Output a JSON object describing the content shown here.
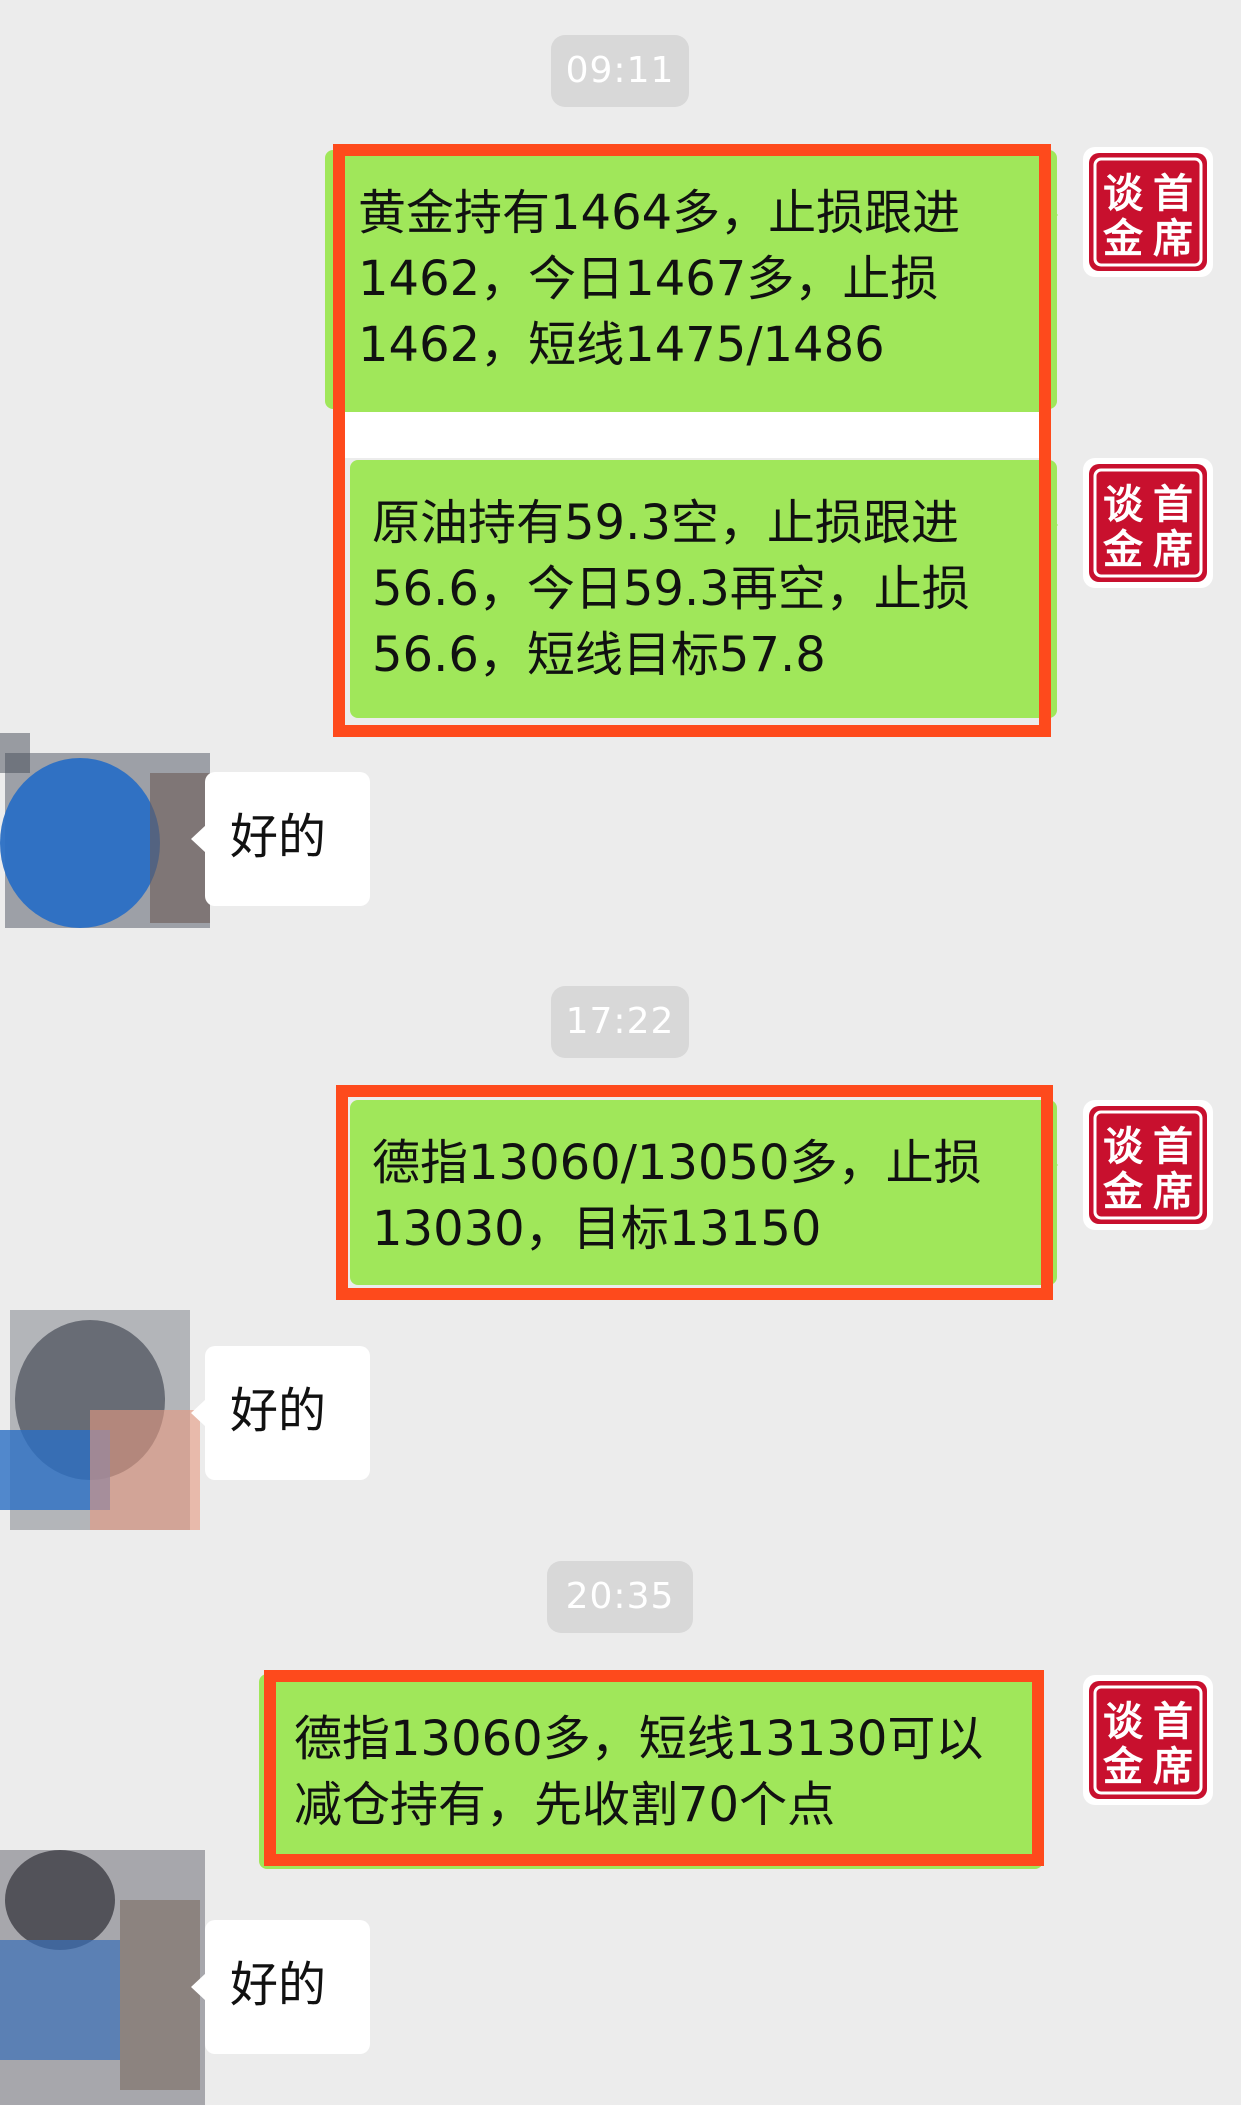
{
  "chat": {
    "timestamps": [
      "09:11",
      "17:22",
      "20:35"
    ],
    "sender_avatar": {
      "name": "seal-logo",
      "text": "谈首金席",
      "color": "#c8102e"
    },
    "outgoing": [
      {
        "text": "黄金持有1464多，止损跟进\n1462，今日1467多，止损\n1462，短线1475/1486"
      },
      {
        "text": "原油持有59.3空，止损跟进\n56.6，今日59.3再空，止损\n56.6，短线目标57.8"
      },
      {
        "text": "德指13060/13050多，止损\n13030，目标13150"
      },
      {
        "text": "德指13060多，短线13130可以\n减仓持有，先收割70个点"
      }
    ],
    "incoming": [
      {
        "text": "好的"
      },
      {
        "text": "好的"
      },
      {
        "text": "好的"
      }
    ],
    "colors": {
      "background": "#ececec",
      "outgoing_bubble": "#a0e75a",
      "incoming_bubble": "#ffffff",
      "timestamp_bg": "#d8d8d8",
      "highlight_border": "#fe4a1c"
    }
  }
}
